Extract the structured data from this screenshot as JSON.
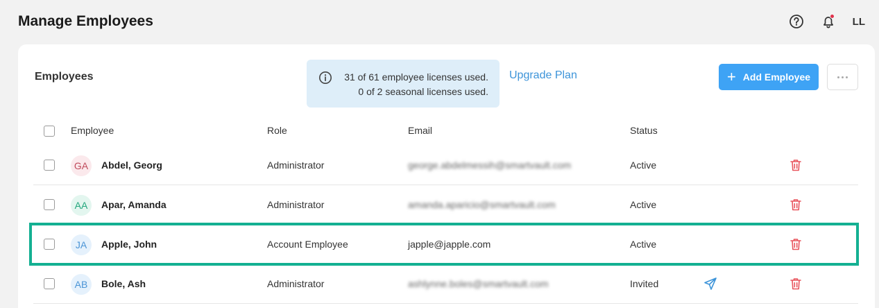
{
  "header": {
    "title": "Manage Employees",
    "help_icon": "help-circle-icon",
    "bell_icon": "bell-icon",
    "user_initials": "LL",
    "notification_dot_color": "#e0314b"
  },
  "card": {
    "title": "Employees",
    "license": {
      "line1": "31 of 61 employee licenses used.",
      "line2": "0 of 2 seasonal licenses used."
    },
    "upgrade_link": "Upgrade Plan",
    "add_button": "Add Employee",
    "accent_color": "#3ea3f5"
  },
  "table": {
    "columns": {
      "employee": "Employee",
      "role": "Role",
      "email": "Email",
      "status": "Status"
    },
    "rows": [
      {
        "initials": "GA",
        "name": "Abdel, Georg",
        "role": "Administrator",
        "email": "george.abdelmessih@smartvault.com",
        "status": "Active"
      },
      {
        "initials": "AA",
        "name": "Apar, Amanda",
        "role": "Administrator",
        "email": "amanda.aparicio@smartvault.com",
        "status": "Active"
      },
      {
        "initials": "JA",
        "name": "Apple, John",
        "role": "Account Employee",
        "email": "japple@japple.com",
        "status": "Active"
      },
      {
        "initials": "AB",
        "name": "Bole, Ash",
        "role": "Administrator",
        "email": "ashlynne.boles@smartvault.com",
        "status": "Invited"
      }
    ]
  },
  "highlight_color": "#14b092"
}
